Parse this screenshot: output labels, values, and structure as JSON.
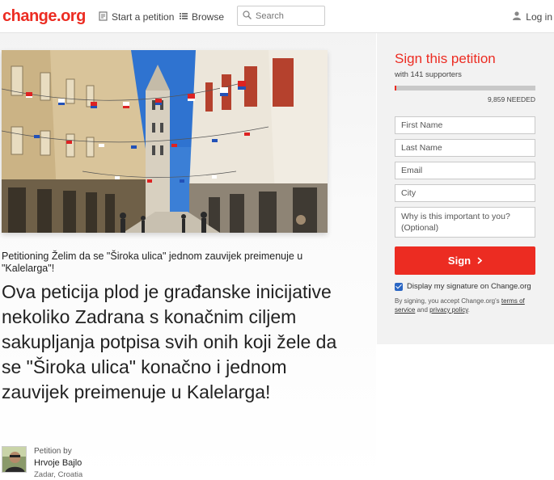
{
  "header": {
    "logo": "change.org",
    "start_petition": "Start a petition",
    "browse": "Browse",
    "search_placeholder": "Search",
    "login": "Log in"
  },
  "petition": {
    "petitioning": "Petitioning Želim da se \"Široka ulica\" jednom zauvijek preimenuje u \"Kalelarga\"!",
    "headline": "Ova peticija plod je građanske inicijative nekoliko Zadrana s konačnim ciljem sakupljanja potpisa svih onih koji žele da se \"Široka ulica\" konačno i jednom zauvijek preimenuje u Kalelarga!",
    "petition_by_label": "Petition by",
    "author_name": "Hrvoje Bajlo",
    "author_location": "Zadar, Croatia"
  },
  "sign": {
    "title": "Sign this petition",
    "supporters": "with 141 supporters",
    "progress_fraction": 0.014,
    "needed": "9,859 NEEDED",
    "first_name_placeholder": "First Name",
    "last_name_placeholder": "Last Name",
    "email_placeholder": "Email",
    "city_placeholder": "City",
    "why_placeholder": "Why is this important to you? (Optional)",
    "button_label": "Sign",
    "display_signature": "Display my signature on Change.org",
    "terms_prefix": "By signing, you accept Change.org's",
    "terms_link": "terms of service",
    "terms_and": "and",
    "privacy_link": "privacy policy",
    "terms_suffix": "."
  },
  "colors": {
    "brand": "#ec2c22",
    "checkbox": "#2a66c4"
  },
  "icons": {
    "start_petition": "document-icon",
    "browse": "list-icon",
    "search": "search-icon",
    "login": "user-icon",
    "sign_button": "chevron-right-icon"
  }
}
